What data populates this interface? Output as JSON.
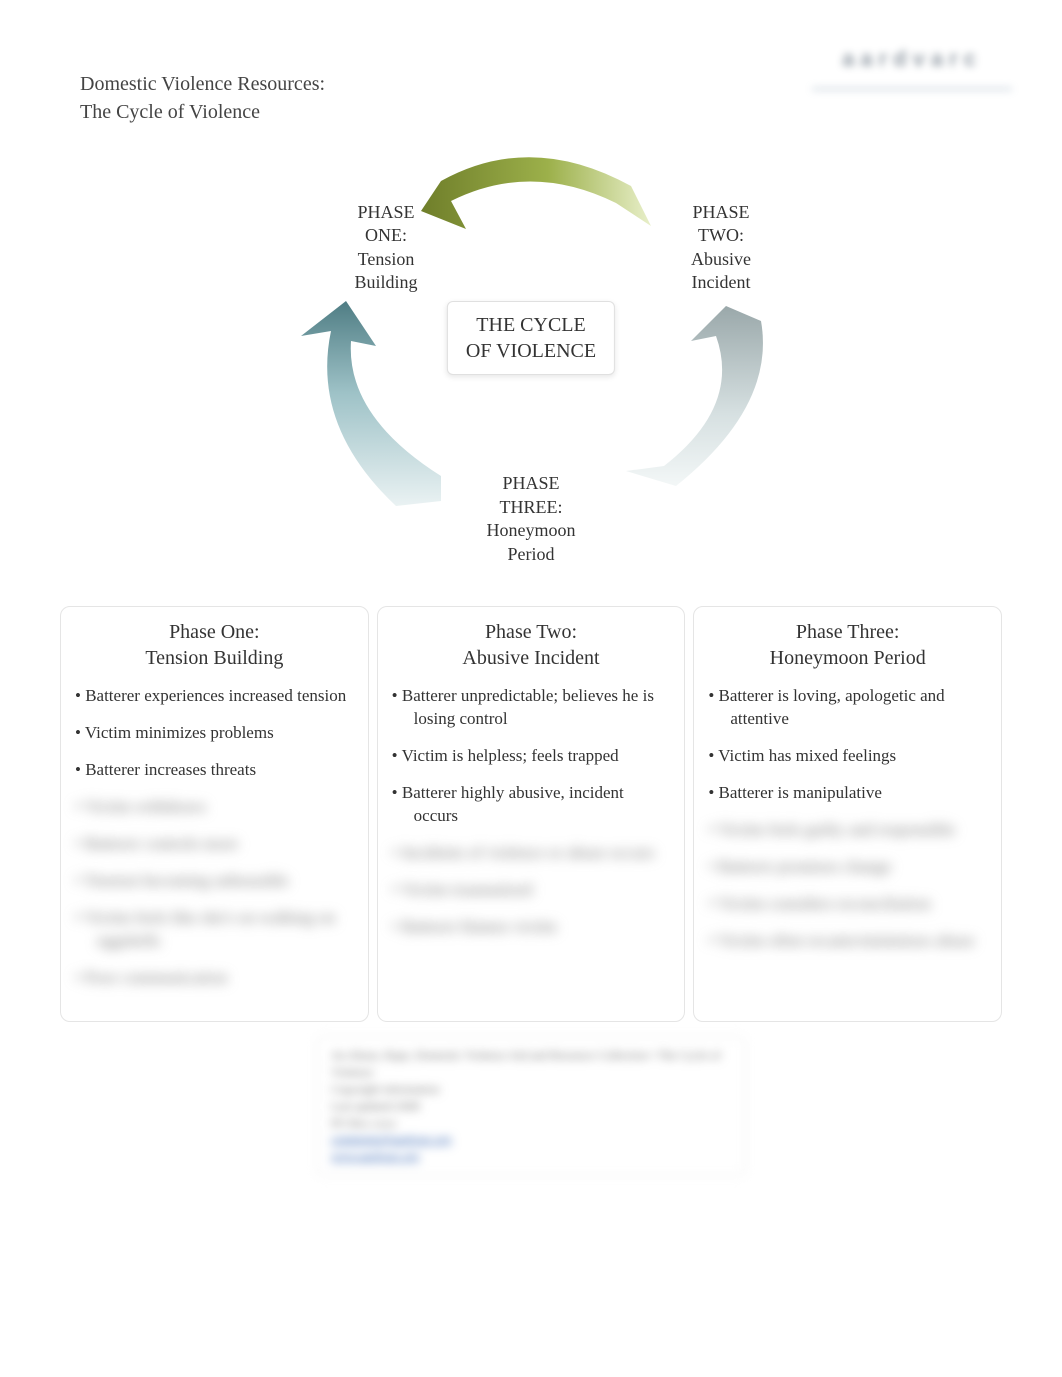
{
  "header": {
    "title_line1": "Domestic Violence Resources:",
    "title_line2": "The Cycle of Violence",
    "logo_text": "aardvarc"
  },
  "cycle": {
    "center_line1": "THE CYCLE",
    "center_line2": "OF VIOLENCE",
    "phase1_l1": "PHASE",
    "phase1_l2": "ONE:",
    "phase1_l3": "Tension",
    "phase1_l4": "Building",
    "phase2_l1": "PHASE",
    "phase2_l2": "TWO:",
    "phase2_l3": "Abusive",
    "phase2_l4": "Incident",
    "phase3_l1": "PHASE",
    "phase3_l2": "THREE:",
    "phase3_l3": "Honeymoon",
    "phase3_l4": "Period"
  },
  "columns": [
    {
      "title_l1": "Phase One:",
      "title_l2": "Tension Building",
      "items": [
        "Batterer experiences increased tension",
        "Victim minimizes problems",
        "Batterer increases threats",
        "Victim withdraws",
        "Batterer controls more",
        "Tension becoming unbearable",
        "Victim feels like she's on walking on eggshells",
        "Poor communication"
      ]
    },
    {
      "title_l1": "Phase Two:",
      "title_l2": "Abusive Incident",
      "items": [
        "Batterer unpredictable; believes he is losing control",
        "Victim is helpless; feels trapped",
        "Batterer highly abusive, incident occurs",
        "Incidents of violence or abuse occurs",
        "Victim traumatized",
        "Batterer blames victim"
      ]
    },
    {
      "title_l1": "Phase Three:",
      "title_l2": "Honeymoon Period",
      "items": [
        "Batterer is loving, apologetic and attentive",
        "Victim has mixed feelings",
        "Batterer is manipulative",
        "Victim feels guilty and responsible",
        "Batterer promises change",
        "Victim considers reconciliation",
        "Victim often recants/minimizes abuse"
      ]
    }
  ],
  "footer": {
    "line1": "An Abuse, Rape, Domestic Violence Aid and Resource Collection • The Cycle of Violence",
    "line2": "Copyright information",
    "line3": "Last updated 2008",
    "line4": "PO Box xxxx",
    "email": "comments@aardvarc.org",
    "url": "www.aardvarc.org"
  },
  "colors": {
    "olive_arrow": "#8a9a3a",
    "teal_arrow": "#5e8c93",
    "gray_arrow": "#b8c4c6"
  }
}
